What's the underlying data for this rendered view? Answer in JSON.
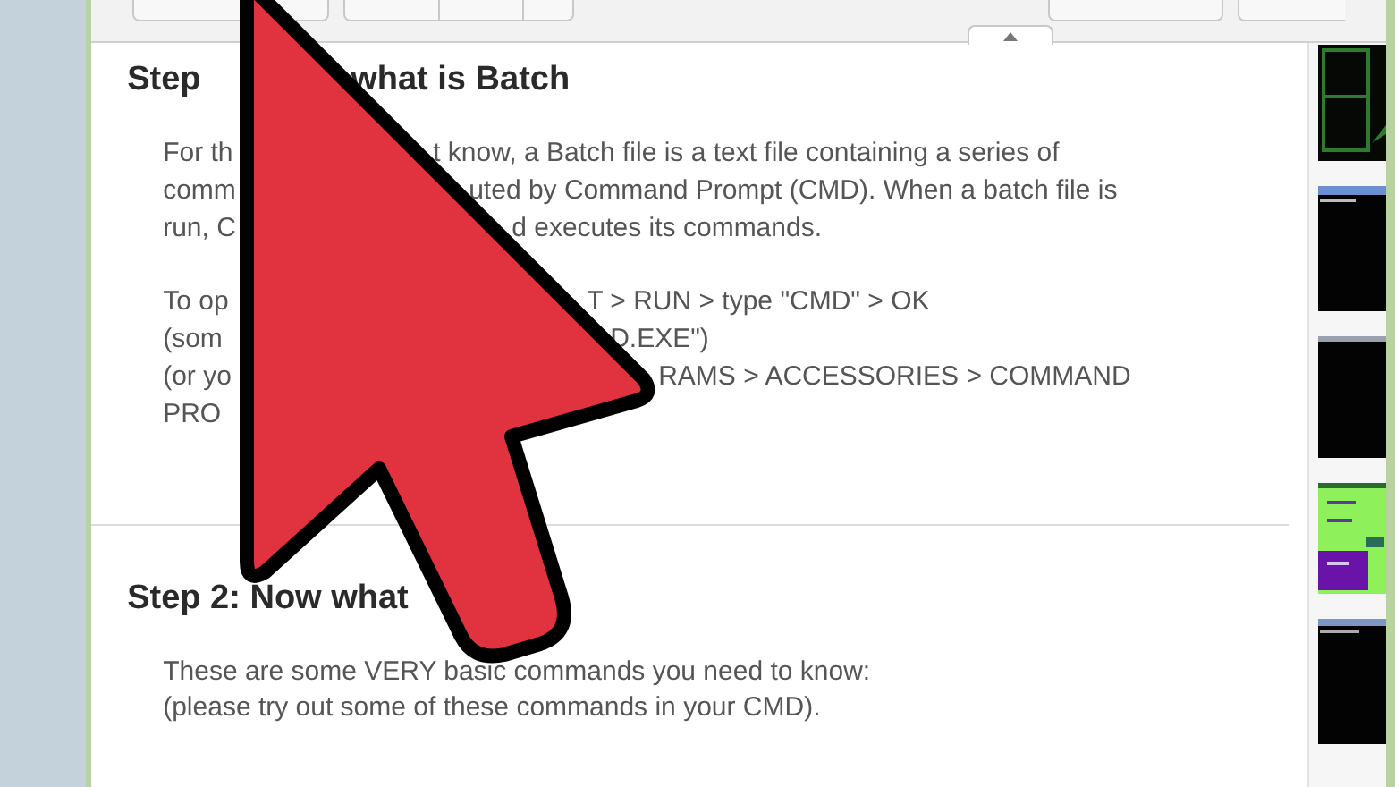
{
  "steps": [
    {
      "heading": {
        "left": "Step",
        "right": "what is Batch"
      },
      "paragraphs": [
        {
          "lines": [
            {
              "left": "For th",
              "right": "t know, a Batch file is a text file containing a series of"
            },
            {
              "left": "comm",
              "right": "uted by Command Prompt (CMD). When a batch file is"
            },
            {
              "left": "run, C",
              "right": "d executes its commands."
            }
          ]
        },
        {
          "lines": [
            {
              "left": "To op",
              "right": "T > RUN > type \"CMD\" > OK"
            },
            {
              "left": "(som",
              "right": "D.EXE\")"
            },
            {
              "left": "(or yo",
              "right": "RAMS > ACCESSORIES > COMMAND"
            },
            {
              "left": "PRO"
            }
          ]
        }
      ]
    },
    {
      "heading": {
        "left": "Step 2: Now what"
      },
      "paragraphs": [
        {
          "lines": [
            {
              "left": "These are some VERY basic commands you need to know:"
            },
            {
              "left": "(please try out some of these commands in your CMD)."
            }
          ]
        }
      ]
    }
  ]
}
